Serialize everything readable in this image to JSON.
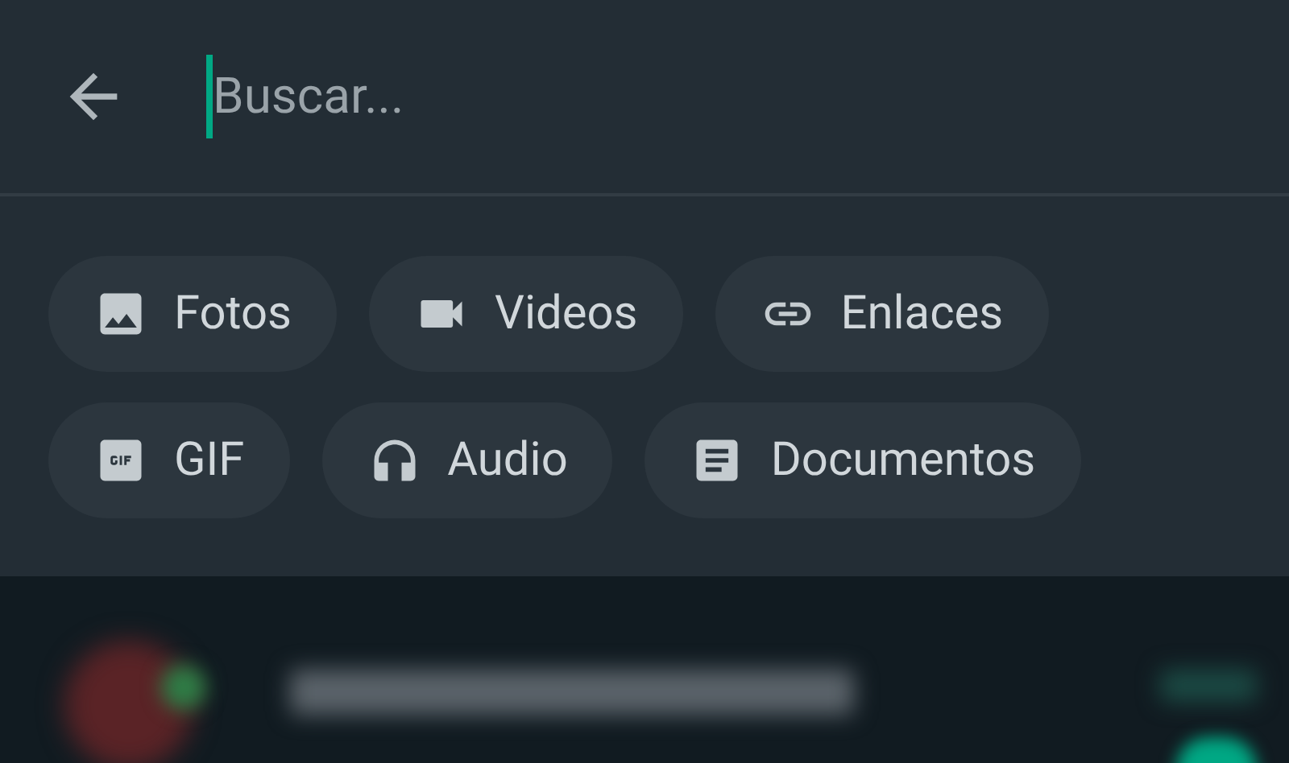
{
  "search": {
    "placeholder": "Buscar..."
  },
  "filters": [
    {
      "kind": "photo",
      "label": "Fotos"
    },
    {
      "kind": "video",
      "label": "Videos"
    },
    {
      "kind": "link",
      "label": "Enlaces"
    },
    {
      "kind": "gif",
      "label": "GIF"
    },
    {
      "kind": "audio",
      "label": "Audio"
    },
    {
      "kind": "document",
      "label": "Documentos"
    }
  ]
}
